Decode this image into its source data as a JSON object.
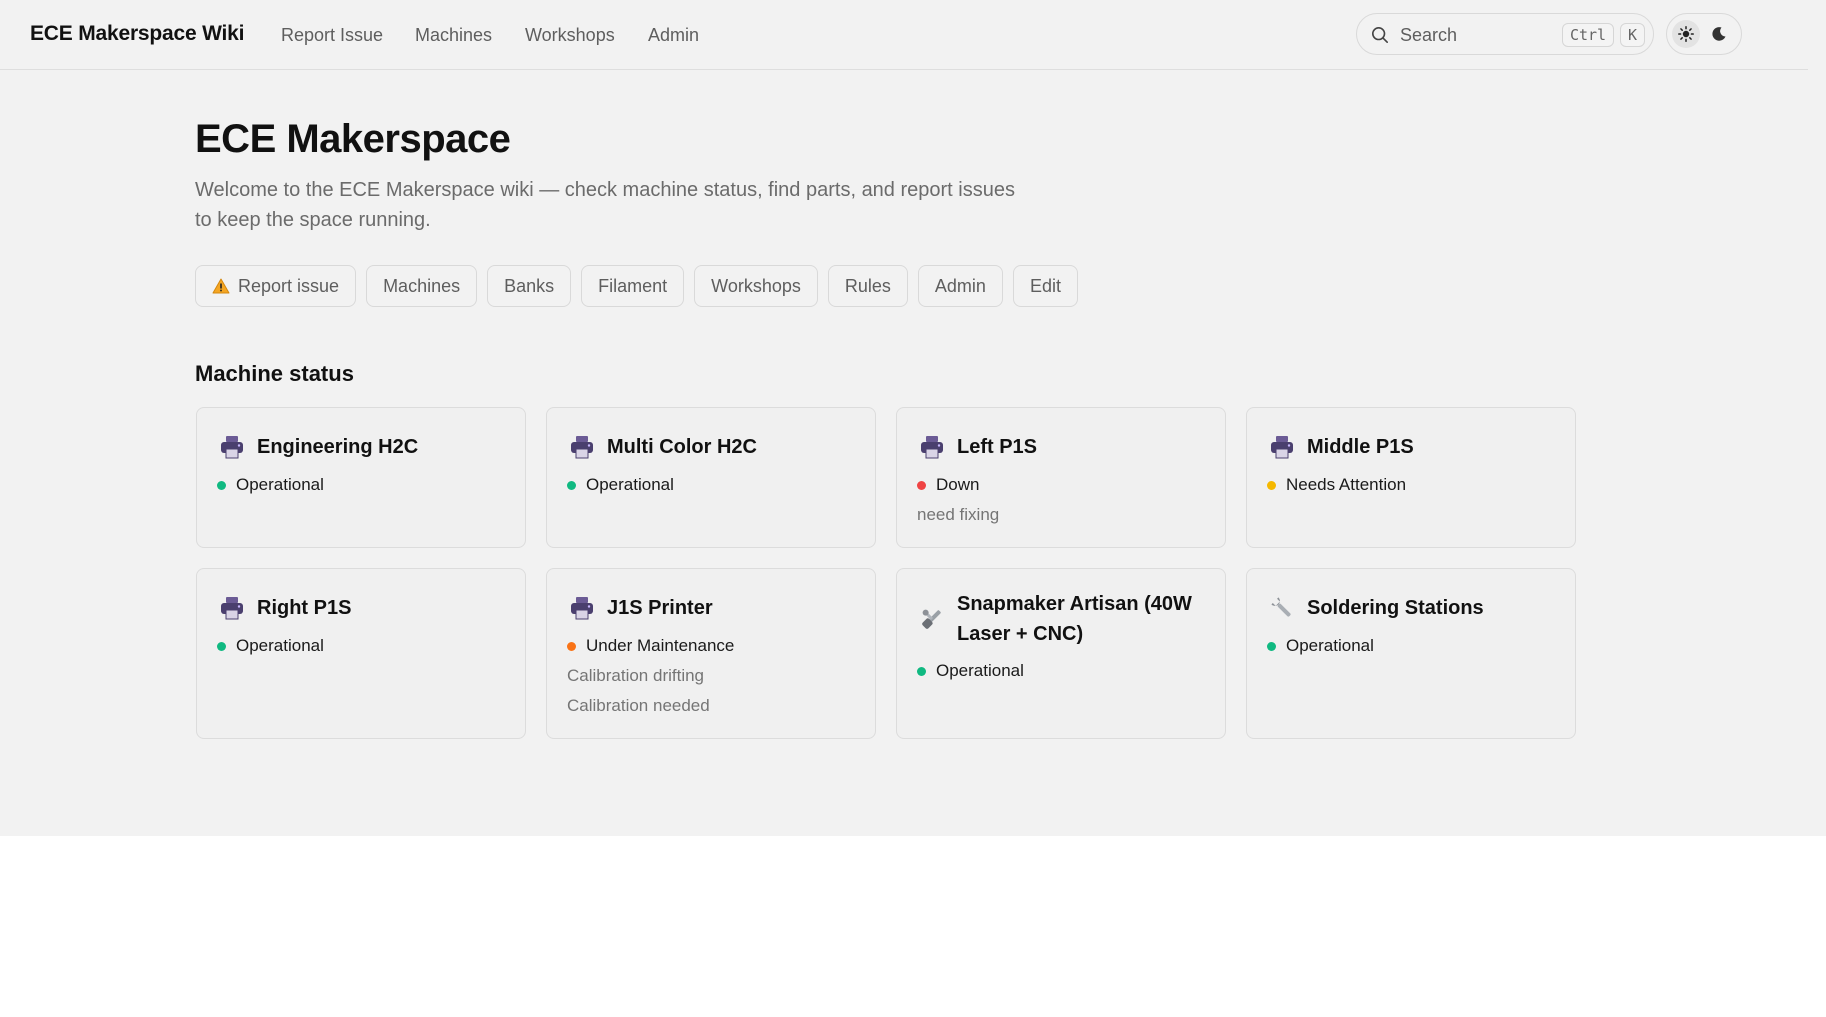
{
  "header": {
    "brand": "ECE Makerspace Wiki",
    "nav": [
      "Report Issue",
      "Machines",
      "Workshops",
      "Admin"
    ],
    "search": {
      "placeholder": "Search",
      "shortcut_keys": [
        "Ctrl",
        "K"
      ]
    },
    "theme_toggle": {
      "options": [
        "light",
        "dark"
      ],
      "selected": "light"
    }
  },
  "hero": {
    "title": "ECE Makerspace",
    "subtitle": "Welcome to the ECE Makerspace wiki — check machine status, find parts, and report issues to keep the space running.",
    "pills": [
      {
        "label": "Report issue",
        "icon": "warning-icon"
      },
      {
        "label": "Machines"
      },
      {
        "label": "Banks"
      },
      {
        "label": "Filament"
      },
      {
        "label": "Workshops"
      },
      {
        "label": "Rules"
      },
      {
        "label": "Admin"
      },
      {
        "label": "Edit"
      }
    ]
  },
  "machine_status": {
    "heading": "Machine status",
    "status_colors": {
      "Operational": "#10b981",
      "Down": "#ef4444",
      "Needs Attention": "#f5b800",
      "Under Maintenance": "#f97316"
    },
    "machines": [
      {
        "name": "Engineering H2C",
        "icon": "printer-icon",
        "status": "Operational",
        "notes": []
      },
      {
        "name": "Multi Color H2C",
        "icon": "printer-icon",
        "status": "Operational",
        "notes": []
      },
      {
        "name": "Left P1S",
        "icon": "printer-icon",
        "status": "Down",
        "notes": [
          "need fixing"
        ]
      },
      {
        "name": "Middle P1S",
        "icon": "printer-icon",
        "status": "Needs Attention",
        "notes": []
      },
      {
        "name": "Right P1S",
        "icon": "printer-icon",
        "status": "Operational",
        "notes": []
      },
      {
        "name": "J1S Printer",
        "icon": "printer-icon",
        "status": "Under Maintenance",
        "notes": [
          "Calibration drifting",
          "Calibration needed"
        ]
      },
      {
        "name": "Snapmaker Artisan (40W Laser + CNC)",
        "icon": "tools-icon",
        "status": "Operational",
        "notes": []
      },
      {
        "name": "Soldering Stations",
        "icon": "wrench-icon",
        "status": "Operational",
        "notes": []
      }
    ]
  }
}
